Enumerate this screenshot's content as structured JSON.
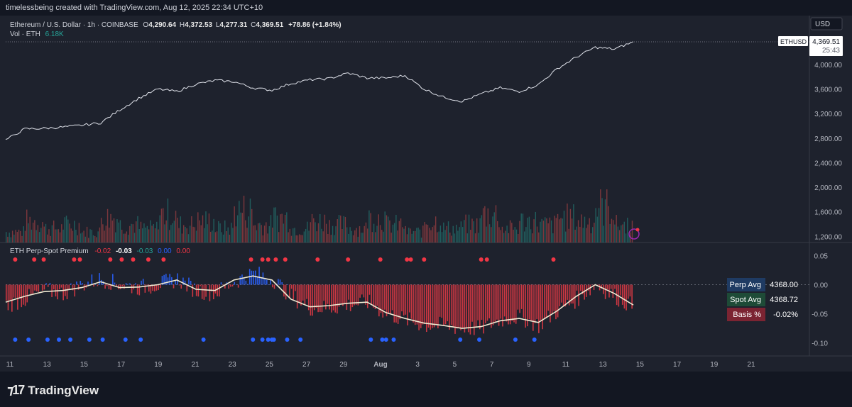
{
  "header": {
    "credit": "timelessbeing created with TradingView.com, Aug 12, 2025 22:34 UTC+10"
  },
  "legend": {
    "symbol": "Ethereum / U.S. Dollar · 1h · COINBASE",
    "o_label": "O",
    "o": "4,290.64",
    "h_label": "H",
    "h": "4,372.53",
    "l_label": "L",
    "l": "4,277.31",
    "c_label": "C",
    "c": "4,369.51",
    "change": "+78.86 (+1.84%)",
    "vol_label": "Vol · ETH",
    "vol": "6.18K"
  },
  "price_axis": {
    "currency": "USD",
    "ticker": "ETHUSD",
    "last_price": "4,369.51",
    "countdown": "25:43",
    "ticks": [
      "4,000.00",
      "3,600.00",
      "3,200.00",
      "2,800.00",
      "2,400.00",
      "2,000.00",
      "1,600.00",
      "1,200.00"
    ]
  },
  "indicator": {
    "title": "ETH Perp-Spot Premium",
    "values": [
      "-0.02",
      "-0.03",
      "-0.03",
      "0.00",
      "0.00"
    ],
    "ticks": [
      "0.05",
      "0.00",
      "-0.05",
      "-0.10"
    ],
    "tags": [
      {
        "label": "Perp Avg",
        "value": "4368.00",
        "color": "#1f3b63"
      },
      {
        "label": "Spot Avg",
        "value": "4368.72",
        "color": "#1e4b37"
      },
      {
        "label": "Basis %",
        "value": "-0.02%",
        "color": "#7b2432"
      }
    ]
  },
  "time_axis": {
    "labels": [
      "11",
      "13",
      "15",
      "17",
      "19",
      "21",
      "23",
      "25",
      "27",
      "29",
      "Aug",
      "3",
      "5",
      "7",
      "9",
      "11",
      "13",
      "15",
      "17",
      "19",
      "21"
    ]
  },
  "brand": {
    "name": "TradingView"
  },
  "colors": {
    "background": "#1e222d",
    "price_line": "#e0e3eb",
    "up": "#26a69a",
    "down": "#ef5350",
    "premium_neg": "#e03a45",
    "premium_pos": "#2962ff",
    "avg_line": "#f0ead2",
    "dot_red": "#f23645",
    "dot_blue": "#2962ff"
  },
  "chart_data": {
    "type": "line",
    "xlabel": "",
    "ylabel": "",
    "x_range": [
      "Jul 10",
      "Aug 12"
    ],
    "ylim": [
      1100,
      4450
    ],
    "series": [
      {
        "type": "line",
        "x": [
          "Jul 10",
          "Jul 11",
          "Jul 12",
          "Jul 13",
          "Jul 14",
          "Jul 15",
          "Jul 16",
          "Jul 17",
          "Jul 18",
          "Jul 19",
          "Jul 20",
          "Jul 21",
          "Jul 22",
          "Jul 23",
          "Jul 24",
          "Jul 25",
          "Jul 26",
          "Jul 27",
          "Jul 28",
          "Jul 29",
          "Jul 30",
          "Jul 31",
          "Aug 1",
          "Aug 2",
          "Aug 3",
          "Aug 4",
          "Aug 5",
          "Aug 6",
          "Aug 7",
          "Aug 8",
          "Aug 9",
          "Aug 10",
          "Aug 11",
          "Aug 12"
        ],
        "values": [
          2770,
          2950,
          2960,
          2980,
          3010,
          3050,
          3260,
          3450,
          3600,
          3560,
          3680,
          3740,
          3720,
          3620,
          3580,
          3690,
          3750,
          3770,
          3860,
          3780,
          3780,
          3820,
          3600,
          3470,
          3400,
          3520,
          3620,
          3560,
          3670,
          3930,
          4120,
          4280,
          4250,
          4369.51
        ]
      }
    ],
    "volume": {
      "type": "bar",
      "ylim": [
        0,
        1
      ],
      "note_units": "relative",
      "values": [
        0.3,
        0.6,
        0.4,
        0.5,
        0.3,
        0.7,
        0.5,
        0.4,
        0.8,
        0.5,
        0.6,
        0.4,
        0.9,
        0.5,
        0.7,
        0.4,
        0.6,
        0.5,
        0.4,
        0.7,
        0.5,
        0.3,
        0.6,
        0.4,
        0.5,
        0.8,
        0.4,
        0.6,
        0.5,
        0.7,
        0.6,
        1.0,
        0.5,
        0.3
      ]
    },
    "premium": {
      "type": "bar",
      "ylim": [
        -0.12,
        0.07
      ],
      "x": [
        "Jul 10",
        "Jul 11",
        "Jul 12",
        "Jul 13",
        "Jul 14",
        "Jul 15",
        "Jul 16",
        "Jul 17",
        "Jul 18",
        "Jul 19",
        "Jul 20",
        "Jul 21",
        "Jul 22",
        "Jul 23",
        "Jul 24",
        "Jul 25",
        "Jul 26",
        "Jul 27",
        "Jul 28",
        "Jul 29",
        "Jul 30",
        "Jul 31",
        "Aug 1",
        "Aug 2",
        "Aug 3",
        "Aug 4",
        "Aug 5",
        "Aug 6",
        "Aug 7",
        "Aug 8",
        "Aug 9",
        "Aug 10",
        "Aug 11",
        "Aug 12"
      ],
      "values": [
        -0.035,
        -0.025,
        -0.01,
        -0.015,
        0.0,
        0.01,
        0.0,
        -0.005,
        0.0,
        0.01,
        -0.01,
        -0.015,
        0.005,
        0.02,
        0.01,
        -0.02,
        -0.04,
        -0.04,
        -0.035,
        -0.03,
        -0.05,
        -0.06,
        -0.07,
        -0.07,
        -0.075,
        -0.075,
        -0.06,
        -0.055,
        -0.07,
        -0.045,
        -0.025,
        0.0,
        -0.02,
        -0.038
      ],
      "avg_line": [
        -0.03,
        -0.02,
        -0.012,
        -0.01,
        -0.005,
        0.005,
        -0.005,
        -0.004,
        0.0,
        0.008,
        -0.008,
        -0.01,
        0.008,
        0.015,
        0.008,
        -0.025,
        -0.038,
        -0.036,
        -0.032,
        -0.03,
        -0.048,
        -0.058,
        -0.066,
        -0.07,
        -0.075,
        -0.072,
        -0.062,
        -0.058,
        -0.065,
        -0.045,
        -0.02,
        0.0,
        -0.015,
        -0.035
      ],
      "red_dots_x": [
        0.5,
        1.5,
        2.0,
        3.6,
        3.9,
        5.5,
        6.1,
        6.7,
        7.5,
        8.3,
        12.9,
        13.5,
        13.8,
        14.2,
        14.7,
        16.4,
        18.0,
        19.7,
        21.1,
        21.3,
        22.0,
        25.0,
        25.3,
        28.8
      ],
      "blue_dots_x": [
        0.5,
        1.2,
        2.2,
        2.8,
        3.4,
        4.4,
        5.1,
        6.3,
        7.1,
        10.4,
        13.0,
        13.5,
        13.8,
        14.0,
        14.1,
        14.8,
        15.5,
        19.2,
        19.8,
        20.0,
        20.4,
        23.9,
        24.9,
        26.8,
        27.8
      ]
    }
  }
}
